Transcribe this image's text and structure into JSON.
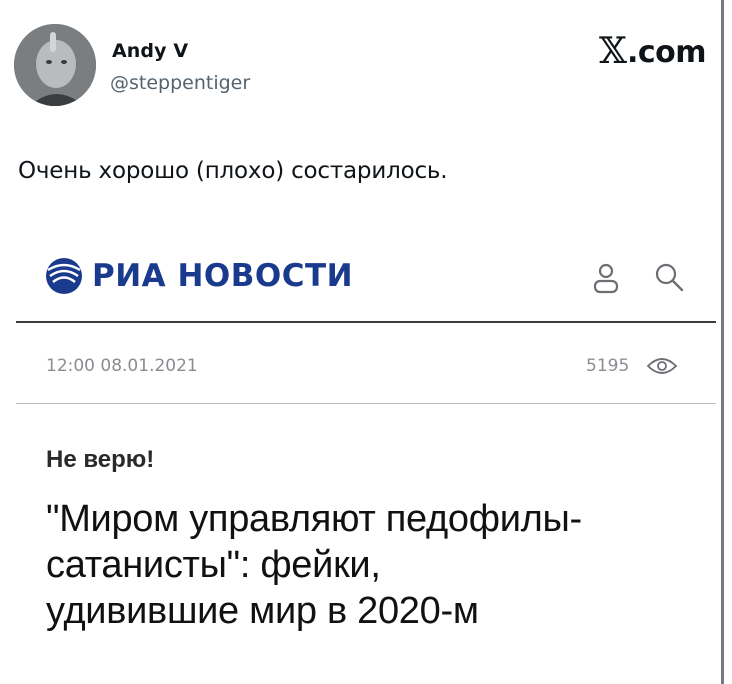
{
  "tweet": {
    "author_name": "Andy V",
    "author_handle": "@steppentiger",
    "brand_x": "𝕏",
    "brand_com": ".com",
    "text": "Очень хорошо (плохо) состарилось."
  },
  "article": {
    "site_name": "РИА НОВОСТИ",
    "datetime": "12:00 08.01.2021",
    "views": "5195",
    "rubric": "Не верю!",
    "headline_lines": [
      "\"Миром управляют педофилы-",
      "сатанисты\": фейки,",
      "удивившие мир в 2020-м"
    ]
  },
  "colors": {
    "ria_blue": "#1a3a8e",
    "handle_gray": "#536471",
    "meta_gray": "#8a8d91"
  },
  "icons": [
    "avatar",
    "ria-logo-icon",
    "profile-icon",
    "search-icon",
    "eye-icon"
  ]
}
